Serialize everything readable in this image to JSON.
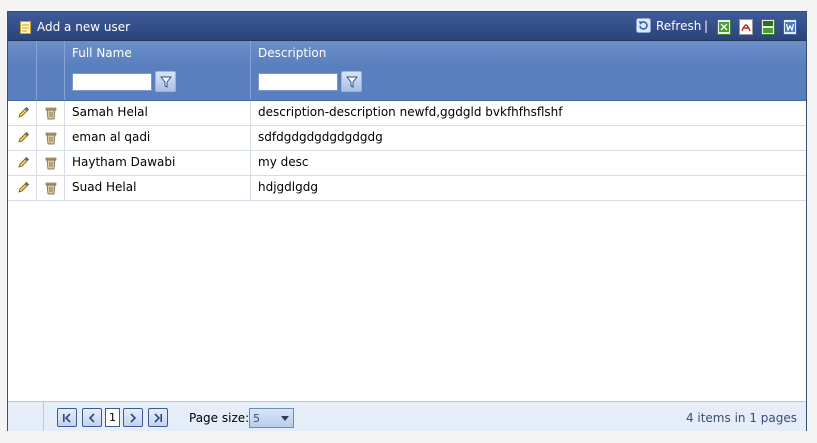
{
  "toolbar": {
    "add_label": "Add a new user",
    "refresh_label": "Refresh",
    "separator": "|"
  },
  "columns": {
    "name_header": "Full Name",
    "description_header": "Description"
  },
  "filters": {
    "name_value": "",
    "description_value": ""
  },
  "rows": [
    {
      "name": "Samah Helal",
      "description": "description-description newfd,ggdgld bvkfhfhsflshf"
    },
    {
      "name": "eman al qadi",
      "description": "sdfdgdgdgdgdgdgdg"
    },
    {
      "name": "Haytham Dawabi",
      "description": "my desc"
    },
    {
      "name": "Suad Helal",
      "description": "hdjgdlgdg"
    }
  ],
  "pager": {
    "current_page": "1",
    "page_size_label": "Page size:",
    "page_size_value": "5",
    "info": "4 items in 1 pages"
  },
  "colors": {
    "header_bar": "#2a437a",
    "column_header": "#5a7fbe",
    "pager_bg": "#e4edf8"
  }
}
